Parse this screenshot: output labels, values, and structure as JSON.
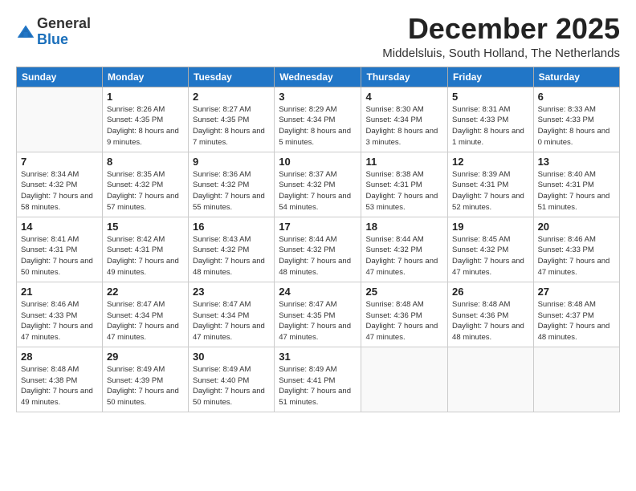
{
  "logo": {
    "general": "General",
    "blue": "Blue"
  },
  "title": {
    "month": "December 2025",
    "location": "Middelsluis, South Holland, The Netherlands"
  },
  "days_of_week": [
    "Sunday",
    "Monday",
    "Tuesday",
    "Wednesday",
    "Thursday",
    "Friday",
    "Saturday"
  ],
  "weeks": [
    [
      {
        "day": "",
        "info": ""
      },
      {
        "day": "1",
        "info": "Sunrise: 8:26 AM\nSunset: 4:35 PM\nDaylight: 8 hours\nand 9 minutes."
      },
      {
        "day": "2",
        "info": "Sunrise: 8:27 AM\nSunset: 4:35 PM\nDaylight: 8 hours\nand 7 minutes."
      },
      {
        "day": "3",
        "info": "Sunrise: 8:29 AM\nSunset: 4:34 PM\nDaylight: 8 hours\nand 5 minutes."
      },
      {
        "day": "4",
        "info": "Sunrise: 8:30 AM\nSunset: 4:34 PM\nDaylight: 8 hours\nand 3 minutes."
      },
      {
        "day": "5",
        "info": "Sunrise: 8:31 AM\nSunset: 4:33 PM\nDaylight: 8 hours\nand 1 minute."
      },
      {
        "day": "6",
        "info": "Sunrise: 8:33 AM\nSunset: 4:33 PM\nDaylight: 8 hours\nand 0 minutes."
      }
    ],
    [
      {
        "day": "7",
        "info": "Sunrise: 8:34 AM\nSunset: 4:32 PM\nDaylight: 7 hours\nand 58 minutes."
      },
      {
        "day": "8",
        "info": "Sunrise: 8:35 AM\nSunset: 4:32 PM\nDaylight: 7 hours\nand 57 minutes."
      },
      {
        "day": "9",
        "info": "Sunrise: 8:36 AM\nSunset: 4:32 PM\nDaylight: 7 hours\nand 55 minutes."
      },
      {
        "day": "10",
        "info": "Sunrise: 8:37 AM\nSunset: 4:32 PM\nDaylight: 7 hours\nand 54 minutes."
      },
      {
        "day": "11",
        "info": "Sunrise: 8:38 AM\nSunset: 4:31 PM\nDaylight: 7 hours\nand 53 minutes."
      },
      {
        "day": "12",
        "info": "Sunrise: 8:39 AM\nSunset: 4:31 PM\nDaylight: 7 hours\nand 52 minutes."
      },
      {
        "day": "13",
        "info": "Sunrise: 8:40 AM\nSunset: 4:31 PM\nDaylight: 7 hours\nand 51 minutes."
      }
    ],
    [
      {
        "day": "14",
        "info": "Sunrise: 8:41 AM\nSunset: 4:31 PM\nDaylight: 7 hours\nand 50 minutes."
      },
      {
        "day": "15",
        "info": "Sunrise: 8:42 AM\nSunset: 4:31 PM\nDaylight: 7 hours\nand 49 minutes."
      },
      {
        "day": "16",
        "info": "Sunrise: 8:43 AM\nSunset: 4:32 PM\nDaylight: 7 hours\nand 48 minutes."
      },
      {
        "day": "17",
        "info": "Sunrise: 8:44 AM\nSunset: 4:32 PM\nDaylight: 7 hours\nand 48 minutes."
      },
      {
        "day": "18",
        "info": "Sunrise: 8:44 AM\nSunset: 4:32 PM\nDaylight: 7 hours\nand 47 minutes."
      },
      {
        "day": "19",
        "info": "Sunrise: 8:45 AM\nSunset: 4:32 PM\nDaylight: 7 hours\nand 47 minutes."
      },
      {
        "day": "20",
        "info": "Sunrise: 8:46 AM\nSunset: 4:33 PM\nDaylight: 7 hours\nand 47 minutes."
      }
    ],
    [
      {
        "day": "21",
        "info": "Sunrise: 8:46 AM\nSunset: 4:33 PM\nDaylight: 7 hours\nand 47 minutes."
      },
      {
        "day": "22",
        "info": "Sunrise: 8:47 AM\nSunset: 4:34 PM\nDaylight: 7 hours\nand 47 minutes."
      },
      {
        "day": "23",
        "info": "Sunrise: 8:47 AM\nSunset: 4:34 PM\nDaylight: 7 hours\nand 47 minutes."
      },
      {
        "day": "24",
        "info": "Sunrise: 8:47 AM\nSunset: 4:35 PM\nDaylight: 7 hours\nand 47 minutes."
      },
      {
        "day": "25",
        "info": "Sunrise: 8:48 AM\nSunset: 4:36 PM\nDaylight: 7 hours\nand 47 minutes."
      },
      {
        "day": "26",
        "info": "Sunrise: 8:48 AM\nSunset: 4:36 PM\nDaylight: 7 hours\nand 48 minutes."
      },
      {
        "day": "27",
        "info": "Sunrise: 8:48 AM\nSunset: 4:37 PM\nDaylight: 7 hours\nand 48 minutes."
      }
    ],
    [
      {
        "day": "28",
        "info": "Sunrise: 8:48 AM\nSunset: 4:38 PM\nDaylight: 7 hours\nand 49 minutes."
      },
      {
        "day": "29",
        "info": "Sunrise: 8:49 AM\nSunset: 4:39 PM\nDaylight: 7 hours\nand 50 minutes."
      },
      {
        "day": "30",
        "info": "Sunrise: 8:49 AM\nSunset: 4:40 PM\nDaylight: 7 hours\nand 50 minutes."
      },
      {
        "day": "31",
        "info": "Sunrise: 8:49 AM\nSunset: 4:41 PM\nDaylight: 7 hours\nand 51 minutes."
      },
      {
        "day": "",
        "info": ""
      },
      {
        "day": "",
        "info": ""
      },
      {
        "day": "",
        "info": ""
      }
    ]
  ]
}
